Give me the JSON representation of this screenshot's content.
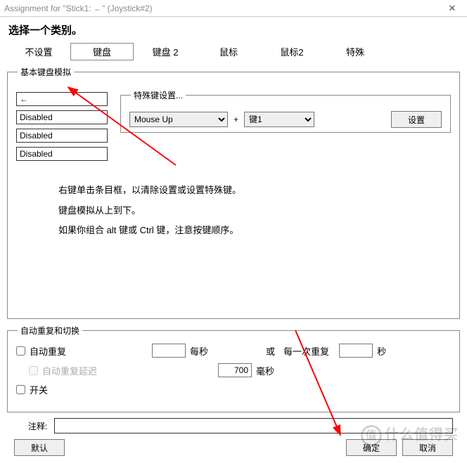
{
  "window": {
    "title": "Assignment for \"Stick1: ←\" (Joystick#2)"
  },
  "heading": "选择一个类别。",
  "tabs": {
    "items": [
      {
        "label": "不设置"
      },
      {
        "label": "键盘"
      },
      {
        "label": "键盘 2"
      },
      {
        "label": "鼠标"
      },
      {
        "label": "鼠标2"
      },
      {
        "label": "特殊"
      }
    ],
    "selected": 1
  },
  "basic_keyboard": {
    "legend": "基本键盘模拟",
    "inputs": [
      "←",
      "Disabled",
      "Disabled",
      "Disabled"
    ],
    "special": {
      "legend": "特殊键设置...",
      "select1": "Mouse Up",
      "plus": "+",
      "select2": "键1",
      "set_btn": "设置"
    },
    "hints": [
      "右键单击条目框，以清除设置或设置特殊键。",
      "键盘模拟从上到下。",
      "如果你组合 alt 键或 Ctrl 键，注意按键顺序。"
    ]
  },
  "auto_repeat": {
    "legend": "自动重复和切换",
    "cb_repeat": "自动重复",
    "per_sec": "每秒",
    "or": "或",
    "each_repeat": "每一次重复",
    "sec": "秒",
    "cb_delay": "自动重复延迟",
    "delay_value": "700",
    "ms": "毫秒",
    "cb_switch": "开关"
  },
  "note_label": "注释:",
  "buttons": {
    "default": "默认",
    "ok": "确定",
    "cancel": "取消"
  },
  "watermark": {
    "icon": "值",
    "text": "什么值得买"
  }
}
